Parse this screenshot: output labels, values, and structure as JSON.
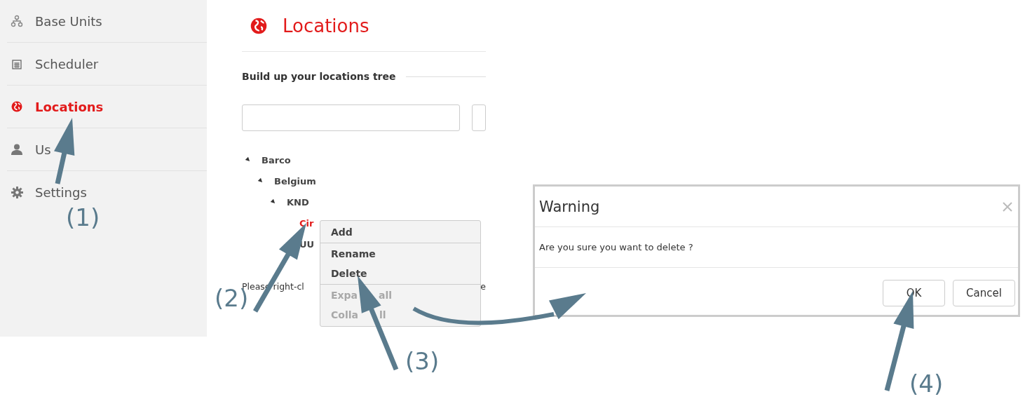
{
  "sidebar": {
    "items": [
      {
        "label": "Base Units",
        "selected": false
      },
      {
        "label": "Scheduler",
        "selected": false
      },
      {
        "label": "Locations",
        "selected": true
      },
      {
        "label": "Us",
        "selected": false
      },
      {
        "label": "Settings",
        "selected": false
      }
    ]
  },
  "page": {
    "title": "Locations",
    "section": "Build up your locations tree",
    "tree": [
      {
        "label": "Barco",
        "expanded": true,
        "selected": false,
        "children": [
          {
            "label": "Belgium",
            "expanded": true,
            "selected": false,
            "children": [
              {
                "label": "KND",
                "expanded": true,
                "selected": false,
                "children": [
                  {
                    "label": "Cir",
                    "selected": true
                  },
                  {
                    "label": "UU",
                    "selected": false
                  }
                ]
              }
            ]
          }
        ]
      }
    ],
    "hint": [
      "Please right-cl",
      "e"
    ],
    "context_menu": [
      {
        "label": "Add",
        "disabled": false
      },
      {
        "label": "Rename",
        "disabled": false
      },
      {
        "label": "Delete",
        "disabled": false
      },
      {
        "label": "Expa",
        "label_end": "all",
        "disabled": true
      },
      {
        "label": "Colla",
        "label_end": "ll",
        "disabled": true
      }
    ]
  },
  "dialog": {
    "title": "Warning",
    "message": "Are you sure you want to delete ?",
    "buttons": [
      "OK",
      "Cancel"
    ]
  },
  "annotations": [
    {
      "label": "(1)"
    },
    {
      "label": "(2)"
    },
    {
      "label": "(3)"
    },
    {
      "label": "(4)"
    }
  ]
}
